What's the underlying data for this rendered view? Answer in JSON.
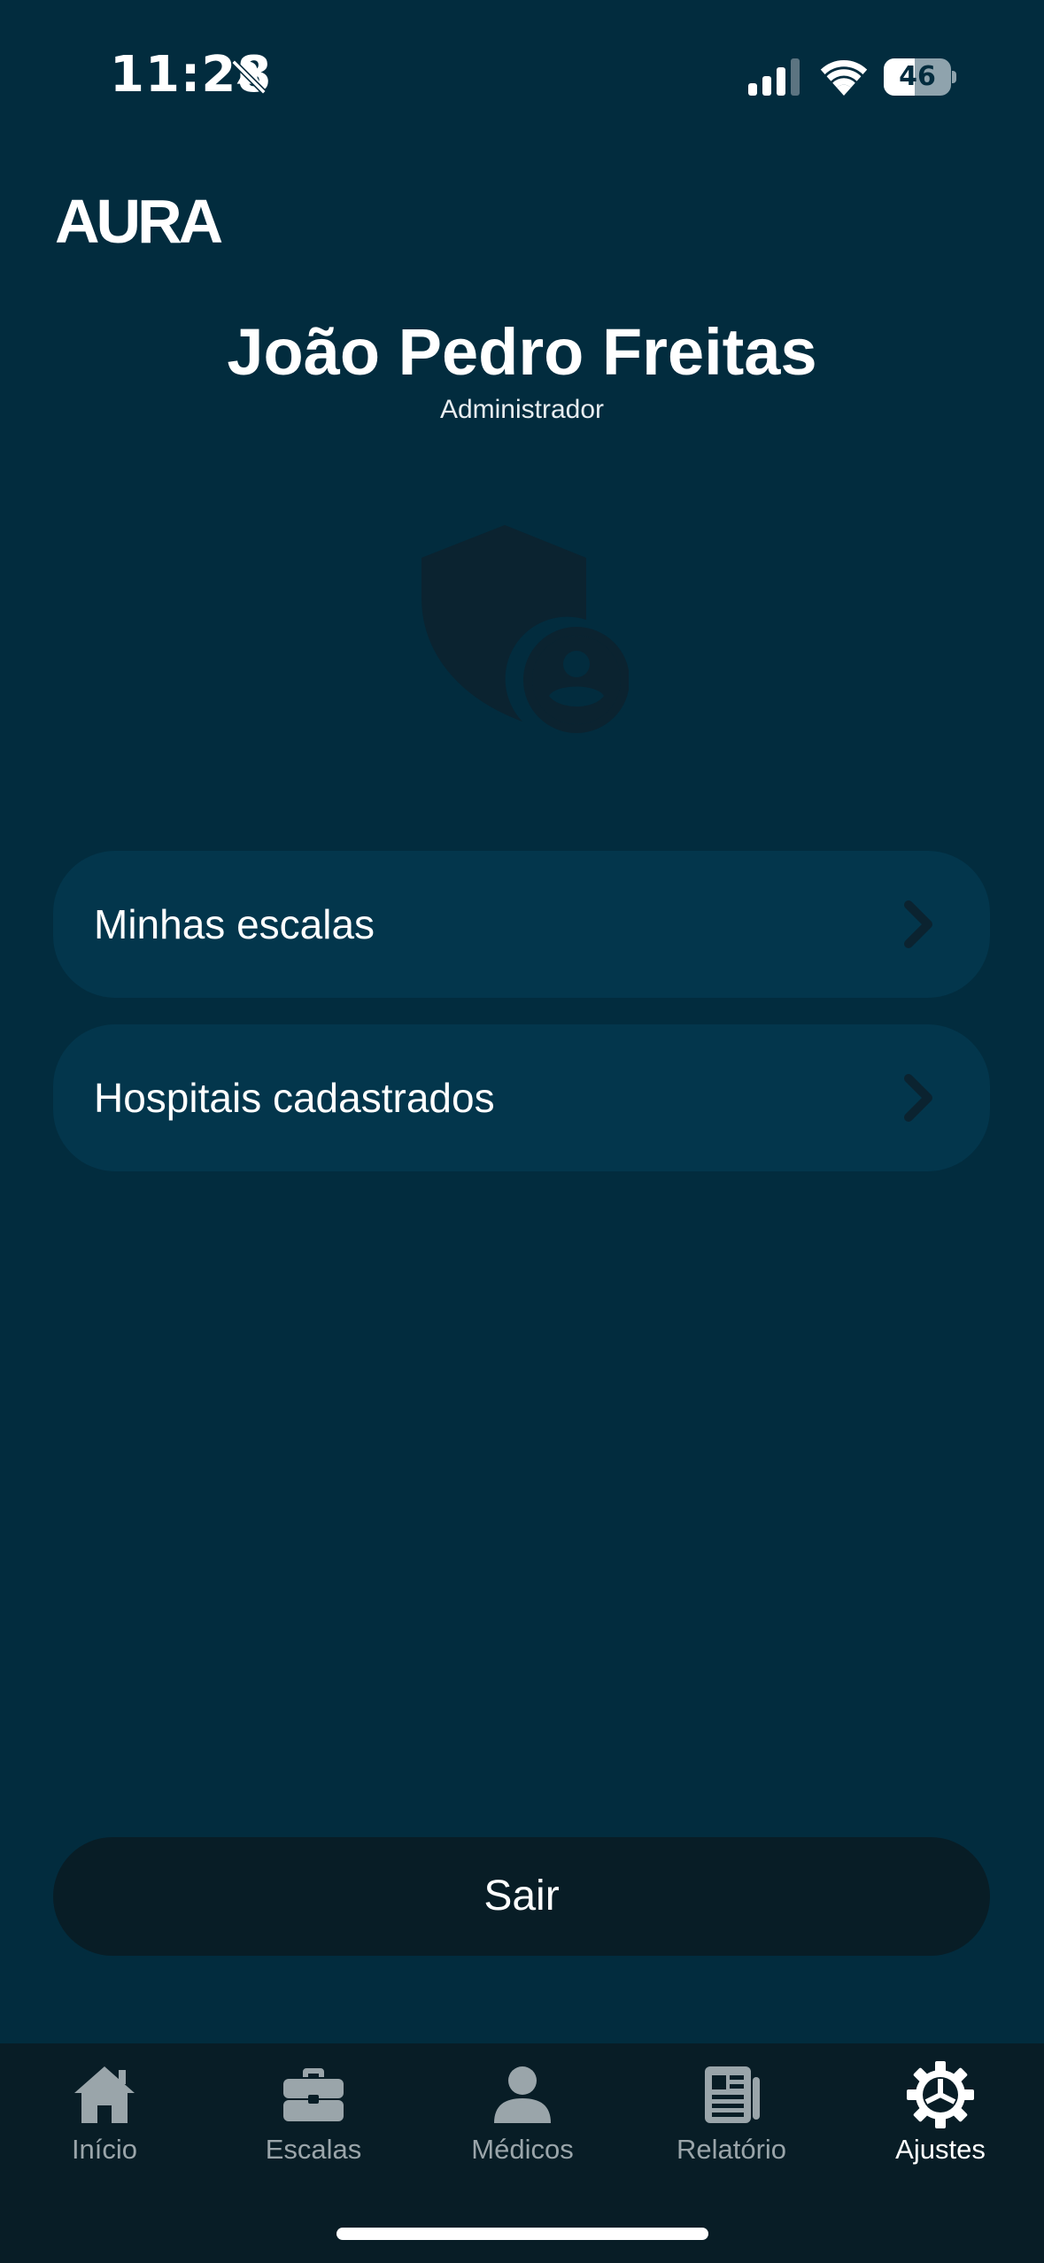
{
  "status_bar": {
    "time": "11:28",
    "battery": "46"
  },
  "app": {
    "logo": "AURA"
  },
  "profile": {
    "name": "João Pedro Freitas",
    "role": "Administrador"
  },
  "menu": {
    "items": [
      {
        "label": "Minhas escalas"
      },
      {
        "label": "Hospitais cadastrados"
      }
    ]
  },
  "logout_label": "Sair",
  "tab_bar": {
    "tabs": [
      {
        "label": "Início",
        "icon": "home-icon"
      },
      {
        "label": "Escalas",
        "icon": "briefcase-icon"
      },
      {
        "label": "Médicos",
        "icon": "person-icon"
      },
      {
        "label": "Relatório",
        "icon": "newspaper-icon"
      },
      {
        "label": "Ajustes",
        "icon": "gear-icon"
      }
    ],
    "active": "Ajustes"
  },
  "colors": {
    "background": "#022c3e",
    "card": "#03364c",
    "dark": "#081d26",
    "inactive_tab": "#9aa5aa"
  }
}
